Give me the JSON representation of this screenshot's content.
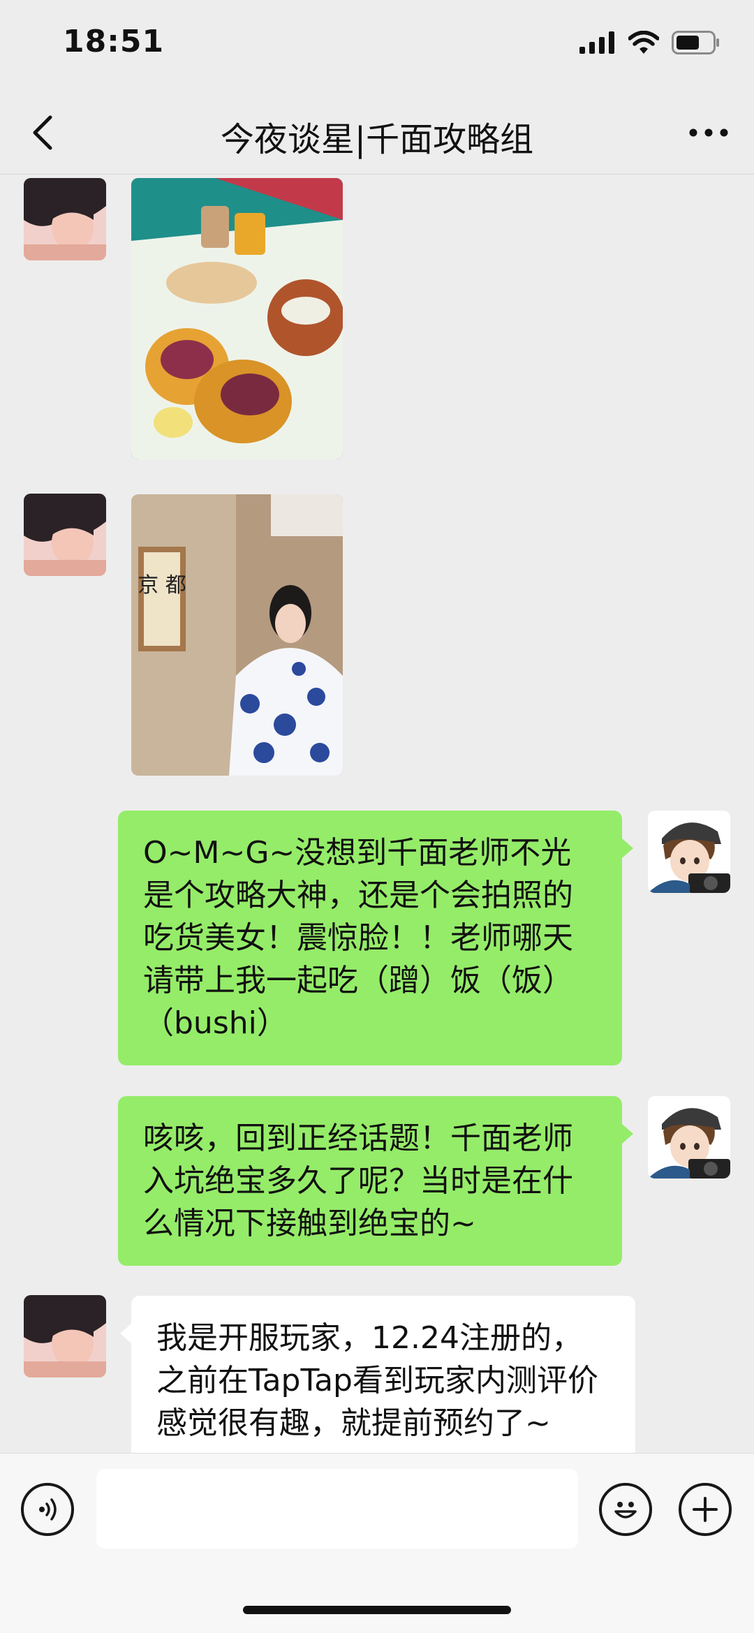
{
  "status_bar": {
    "time": "18:51"
  },
  "nav": {
    "title": "今夜谈星|千面攻略组"
  },
  "messages": [
    {
      "side": "left",
      "type": "image",
      "content": "tacos-food-photo"
    },
    {
      "side": "left",
      "type": "image",
      "content": "woman-kimono-photo",
      "sign_text": "京 都"
    },
    {
      "side": "right",
      "type": "text",
      "text": "O~M~G~没想到千面老师不光是个攻略大神，还是个会拍照的吃货美女！震惊脸！！老师哪天请带上我一起吃（蹭）饭（饭）（bushi）"
    },
    {
      "side": "right",
      "type": "text",
      "text": "咳咳，回到正经话题！千面老师入坑绝宝多久了呢？当时是在什么情况下接触到绝宝的~"
    },
    {
      "side": "left",
      "type": "text",
      "text": "我是开服玩家，12.24注册的，之前在TapTap看到玩家内测评价感觉很有趣，就提前预约了~"
    }
  ],
  "input": {
    "value": "",
    "placeholder": ""
  },
  "colors": {
    "background": "#ededed",
    "sent_bubble": "#95ec69",
    "received_bubble": "#ffffff",
    "input_bar": "#f7f7f7"
  },
  "icons": [
    "back-icon",
    "more-icon",
    "voice-icon",
    "emoji-icon",
    "plus-icon",
    "signal-icon",
    "wifi-icon",
    "battery-icon"
  ]
}
